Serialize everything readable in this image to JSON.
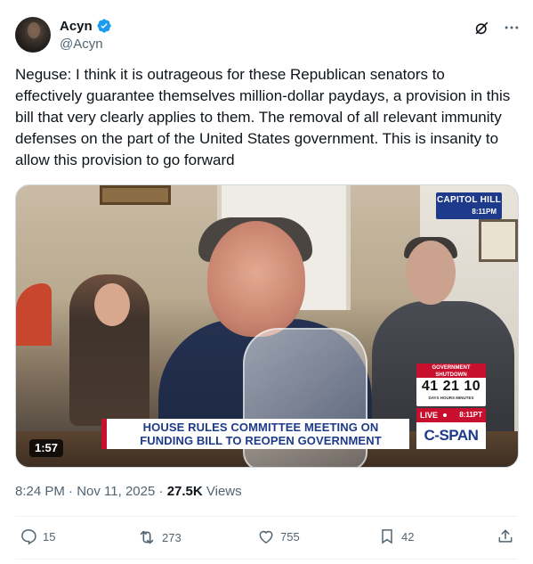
{
  "author": {
    "display_name": "Acyn",
    "handle": "@Acyn",
    "verified": true,
    "verified_color": "#1d9bf0"
  },
  "header_icons": [
    "grok-icon",
    "more-icon"
  ],
  "tweet": {
    "text": "Neguse: I think it is outrageous for these Republican senators to effectively guarantee themselves million-dollar paydays, a provision in this bill that very clearly applies to them. The removal of all relevant immunity defenses on the part of the United States government. This is insanity to allow this provision to go forward"
  },
  "media": {
    "duration": "1:57",
    "network_badge": "CAPITOL HILL",
    "network_badge_time": "8:11PM",
    "shutdown_title": "GOVERNMENT SHUTDOWN",
    "shutdown_counter": "41 21 10",
    "shutdown_units": "DAYS HOURS MINUTES",
    "live_label": "LIVE",
    "live_time": "8:11PT",
    "headline_line1": "HOUSE RULES COMMITTEE MEETING ON",
    "headline_line2": "FUNDING BILL TO REOPEN GOVERNMENT",
    "channel_logo": "C-SPAN"
  },
  "meta": {
    "time": "8:24 PM",
    "separator": "·",
    "date": "Nov 11, 2025",
    "views_count": "27.5K",
    "views_label": "Views"
  },
  "actions": {
    "replies": "15",
    "reposts": "273",
    "likes": "755",
    "bookmarks": "42"
  }
}
